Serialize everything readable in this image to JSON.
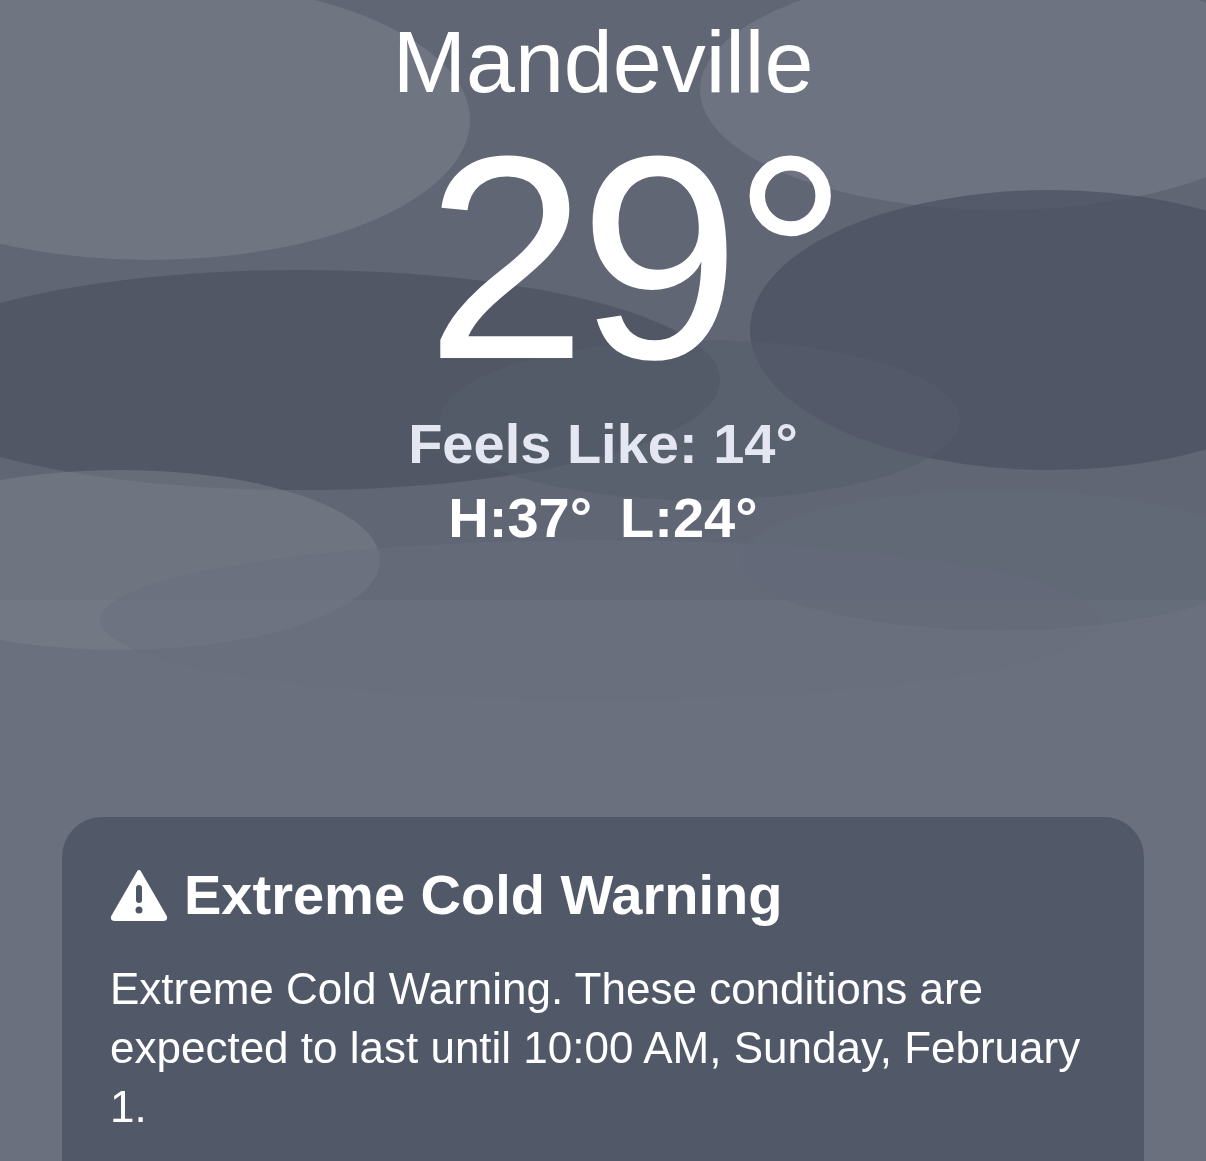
{
  "location": {
    "name": "Mandeville"
  },
  "current": {
    "temperature": "29°",
    "feels_like": "Feels Like: 14°",
    "high": "H:37°",
    "low": "L:24°"
  },
  "alert": {
    "title": "Extreme Cold Warning",
    "body": "Extreme Cold Warning. These conditions are expected to last until 10:00 AM, Sunday, February 1."
  }
}
